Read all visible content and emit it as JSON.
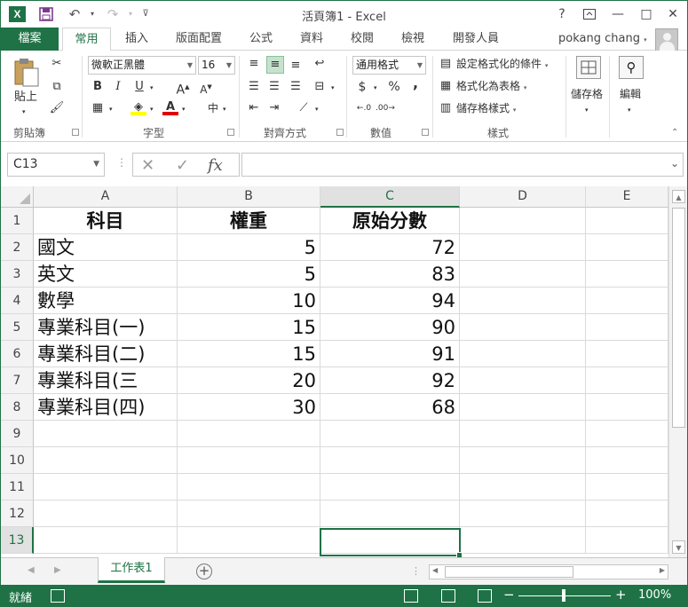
{
  "titlebar": {
    "title": "活頁簿1 - Excel",
    "help": "?",
    "restore": "□",
    "minimize": "—",
    "close": "✕"
  },
  "tabs": {
    "file": "檔案",
    "items": [
      "常用",
      "插入",
      "版面配置",
      "公式",
      "資料",
      "校閱",
      "檢視",
      "開發人員"
    ],
    "active": "常用",
    "user": "pokang chang"
  },
  "ribbon": {
    "clipboard": {
      "paste": "貼上",
      "label": "剪貼簿"
    },
    "font": {
      "name": "微軟正黑體",
      "size": "16",
      "bold": "B",
      "italic": "I",
      "underline": "U",
      "grow": "A",
      "shrink": "A",
      "phonetic": "中",
      "label": "字型"
    },
    "alignment": {
      "label": "對齊方式"
    },
    "number": {
      "format": "通用格式",
      "currency": "$",
      "percent": "%",
      "comma": ",",
      "label": "數值"
    },
    "styles": {
      "conditional": "設定格式化的條件",
      "as_table": "格式化為表格",
      "cell_styles": "儲存格樣式",
      "label": "樣式"
    },
    "cells": {
      "label": "儲存格"
    },
    "editing": {
      "label": "編輯"
    }
  },
  "formula_bar": {
    "name_box": "C13",
    "fx": "fx",
    "value": ""
  },
  "sheet": {
    "columns": [
      "A",
      "B",
      "C",
      "D",
      "E"
    ],
    "selected_column": "C",
    "rows": [
      "1",
      "2",
      "3",
      "4",
      "5",
      "6",
      "7",
      "8",
      "9",
      "10",
      "11",
      "12",
      "13"
    ],
    "selected_row": "13",
    "header": [
      "科目",
      "權重",
      "原始分數"
    ],
    "data": [
      [
        "國文",
        "5",
        "72"
      ],
      [
        "英文",
        "5",
        "83"
      ],
      [
        "數學",
        "10",
        "94"
      ],
      [
        "專業科目(一)",
        "15",
        "90"
      ],
      [
        "專業科目(二)",
        "15",
        "91"
      ],
      [
        "專業科目(三",
        "20",
        "92"
      ],
      [
        "專業科目(四)",
        "30",
        "68"
      ]
    ]
  },
  "sheet_tabs": {
    "active": "工作表1",
    "add": "+"
  },
  "statusbar": {
    "status": "就緒",
    "zoom": "100%",
    "zoom_minus": "−",
    "zoom_plus": "+"
  }
}
